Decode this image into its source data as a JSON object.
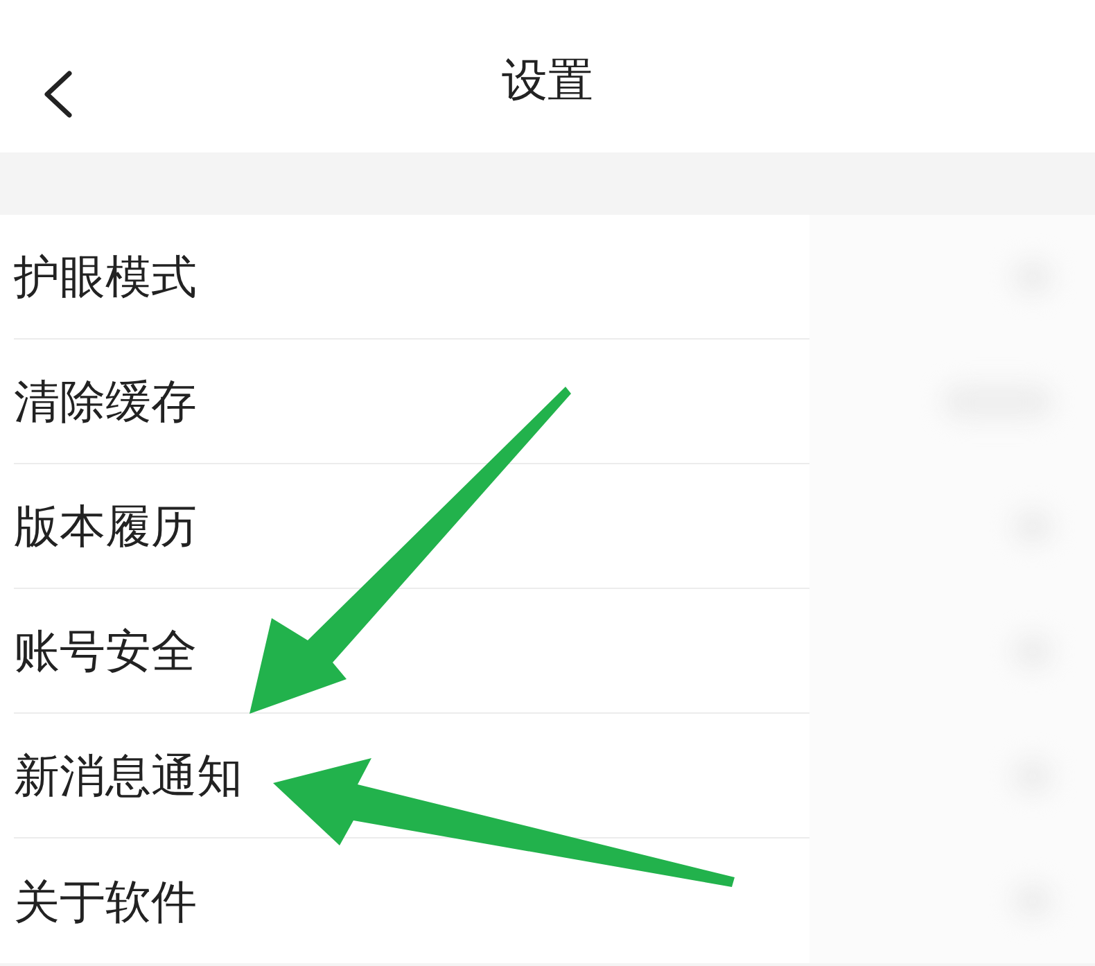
{
  "header": {
    "title": "设置"
  },
  "settings": [
    {
      "label": "护眼模式"
    },
    {
      "label": "清除缓存"
    },
    {
      "label": "版本履历"
    },
    {
      "label": "账号安全"
    },
    {
      "label": "新消息通知"
    },
    {
      "label": "关于软件"
    }
  ]
}
